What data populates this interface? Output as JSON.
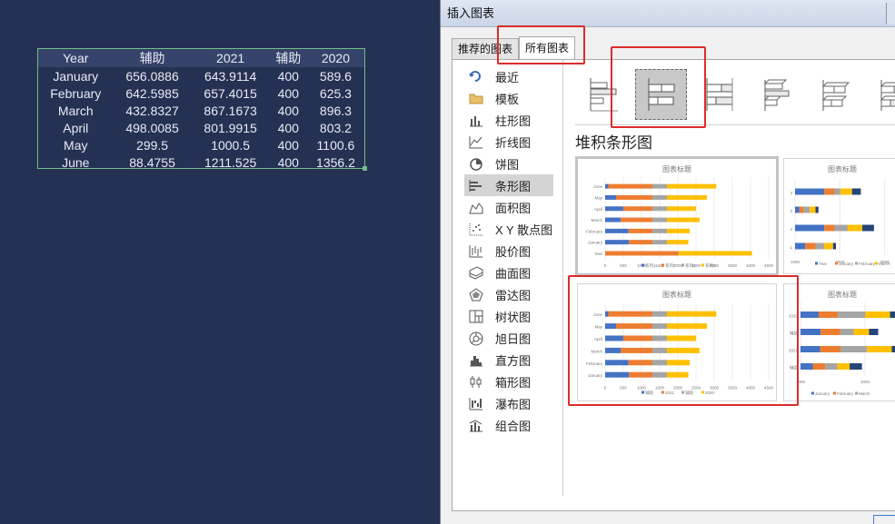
{
  "sheet": {
    "headers": [
      "Year",
      "辅助",
      "2021",
      "辅助",
      "2020"
    ],
    "rows": [
      [
        "January",
        "656.0886",
        "643.9114",
        "400",
        "589.6"
      ],
      [
        "February",
        "642.5985",
        "657.4015",
        "400",
        "625.3"
      ],
      [
        "March",
        "432.8327",
        "867.1673",
        "400",
        "896.3"
      ],
      [
        "April",
        "498.0085",
        "801.9915",
        "400",
        "803.2"
      ],
      [
        "May",
        "299.5",
        "1000.5",
        "400",
        "1100.6"
      ],
      [
        "June",
        "88.4755",
        "1211.525",
        "400",
        "1356.2"
      ]
    ]
  },
  "dialog": {
    "title": "插入图表",
    "tabs": [
      "推荐的图表",
      "所有图表"
    ],
    "sidebar": [
      {
        "label": "最近",
        "icon": "recent-icon"
      },
      {
        "label": "模板",
        "icon": "folder-icon"
      },
      {
        "label": "柱形图",
        "icon": "column-chart-icon"
      },
      {
        "label": "折线图",
        "icon": "line-chart-icon"
      },
      {
        "label": "饼图",
        "icon": "pie-chart-icon"
      },
      {
        "label": "条形图",
        "icon": "bar-chart-icon"
      },
      {
        "label": "面积图",
        "icon": "area-chart-icon"
      },
      {
        "label": "X Y 散点图",
        "icon": "scatter-chart-icon"
      },
      {
        "label": "股价图",
        "icon": "stock-chart-icon"
      },
      {
        "label": "曲面图",
        "icon": "surface-chart-icon"
      },
      {
        "label": "雷达图",
        "icon": "radar-chart-icon"
      },
      {
        "label": "树状图",
        "icon": "treemap-chart-icon"
      },
      {
        "label": "旭日图",
        "icon": "sunburst-chart-icon"
      },
      {
        "label": "直方图",
        "icon": "histogram-chart-icon"
      },
      {
        "label": "箱形图",
        "icon": "box-whisker-chart-icon"
      },
      {
        "label": "瀑布图",
        "icon": "waterfall-chart-icon"
      },
      {
        "label": "组合图",
        "icon": "combo-chart-icon"
      }
    ],
    "selected_category": "条形图",
    "subtype_title": "堆积条形图",
    "previews": {
      "p1": {
        "title": "图表标题",
        "categories": [
          "June",
          "May",
          "April",
          "March",
          "February",
          "January",
          "Year"
        ],
        "xticks": [
          "0",
          "500",
          "1000",
          "1500",
          "2000",
          "2500",
          "3000",
          "3500",
          "4000",
          "4500"
        ],
        "legend": [
          "系列1",
          "系列2",
          "系列3",
          "系列4"
        ]
      },
      "p2": {
        "title": "图表标题",
        "xticks": [
          "1000",
          "2000",
          "3000",
          "4000"
        ],
        "categories": [
          "4",
          "3",
          "2",
          "1"
        ],
        "legend": [
          "Year",
          "January",
          "February",
          "March"
        ]
      },
      "p3": {
        "title": "图表标题",
        "categories": [
          "June",
          "May",
          "April",
          "March",
          "February",
          "January"
        ],
        "xticks": [
          "0",
          "500",
          "1000",
          "1500",
          "2000",
          "2500",
          "3000",
          "3500",
          "4000",
          "4500"
        ],
        "legend": [
          "辅助",
          "2021",
          "辅助",
          "2020"
        ]
      },
      "p4": {
        "title": "图表标题",
        "categories": [
          "2020",
          "辅助",
          "2021",
          "辅助"
        ],
        "xticks": [
          "1000",
          "2000",
          "3000"
        ],
        "legend": [
          "January",
          "February",
          "March"
        ]
      }
    },
    "colors": {
      "blue": "#4472c4",
      "orange": "#ed7d31",
      "gray": "#a5a5a5",
      "yellow": "#ffc000",
      "darkblue": "#264478",
      "green": "#70ad47"
    }
  }
}
